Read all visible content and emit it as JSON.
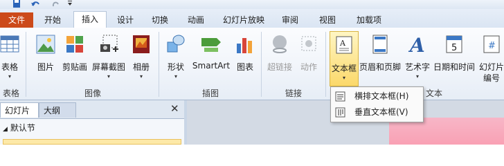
{
  "tabs": [
    {
      "label": "文件"
    },
    {
      "label": "开始"
    },
    {
      "label": "插入"
    },
    {
      "label": "设计"
    },
    {
      "label": "切换"
    },
    {
      "label": "动画"
    },
    {
      "label": "幻灯片放映"
    },
    {
      "label": "审阅"
    },
    {
      "label": "视图"
    },
    {
      "label": "加载项"
    }
  ],
  "ribbon": {
    "table": {
      "label": "表格",
      "group": "表格"
    },
    "images": {
      "picture": "图片",
      "clipart": "剪贴画",
      "screenshot": "屏幕截图",
      "album": "相册",
      "group": "图像"
    },
    "illustrations": {
      "shapes": "形状",
      "smartart": "SmartArt",
      "chart": "图表",
      "group": "插图"
    },
    "links": {
      "hyperlink": "超链接",
      "action": "动作",
      "group": "链接"
    },
    "text": {
      "textbox": "文本框",
      "header_footer": "页眉和页脚",
      "wordart": "艺术字",
      "datetime": "日期和时间",
      "slide_number_1": "幻灯片",
      "slide_number_2": "编号",
      "group": "文本"
    },
    "date_icon_digit": "5"
  },
  "dropdown_arrow": "▾",
  "textbox_menu": [
    {
      "label": "横排文本框(H)"
    },
    {
      "label": "垂直文本框(V)"
    }
  ],
  "panel": {
    "tab_slides": "幻灯片",
    "tab_outline": "大纲",
    "close": "✕",
    "section": "默认节"
  },
  "colors": {
    "file_tab": "#cc4a1a",
    "selected_button": "#fbd86a",
    "slide_canvas": "#f9a1b4"
  }
}
